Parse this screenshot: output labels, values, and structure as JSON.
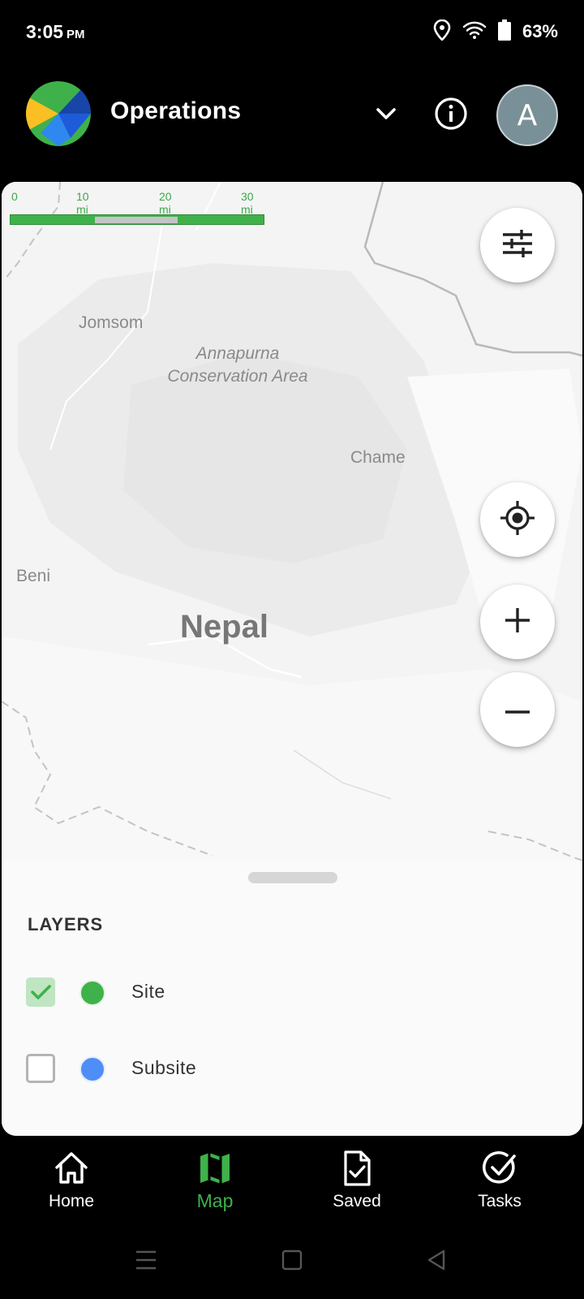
{
  "status_bar": {
    "time": "3:05",
    "ampm": "PM",
    "battery_percent": "63%",
    "icons": [
      "location-icon",
      "wifi-icon",
      "battery-icon"
    ]
  },
  "header": {
    "title": "Operations",
    "avatar_initial": "A",
    "icons": [
      "app-logo",
      "chevron-down-icon",
      "info-icon"
    ]
  },
  "map": {
    "scale_labels": [
      "0",
      "10 mi",
      "20 mi",
      "30 mi"
    ],
    "labels": {
      "jomsom": "Jomsom",
      "annapurna_line1": "Annapurna",
      "annapurna_line2": "Conservation Area",
      "chame": "Chame",
      "beni": "Beni",
      "nepal": "Nepal"
    },
    "controls": [
      "filter-icon",
      "my-location-icon",
      "zoom-in-icon",
      "zoom-out-icon"
    ]
  },
  "layers": {
    "title": "LAYERS",
    "items": [
      {
        "label": "Site",
        "checked": true,
        "color": "#3fb14a"
      },
      {
        "label": "Subsite",
        "checked": false,
        "color": "#4f8ef7"
      }
    ]
  },
  "bottom_nav": {
    "items": [
      {
        "label": "Home",
        "icon": "home-icon",
        "active": false
      },
      {
        "label": "Map",
        "icon": "map-icon",
        "active": true
      },
      {
        "label": "Saved",
        "icon": "saved-icon",
        "active": false
      },
      {
        "label": "Tasks",
        "icon": "tasks-icon",
        "active": false
      }
    ]
  },
  "colors": {
    "accent": "#3fb14a",
    "background": "#000000",
    "map_bg": "#f2f2f2",
    "avatar_bg": "#7a9098"
  }
}
